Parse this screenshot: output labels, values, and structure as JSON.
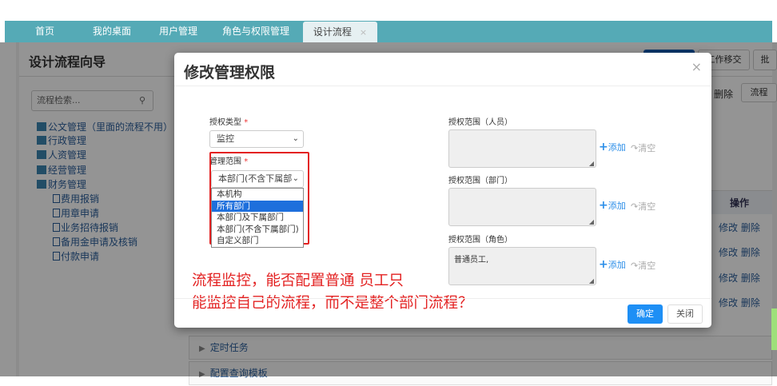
{
  "tabs": [
    {
      "label": "首页"
    },
    {
      "label": "我的桌面"
    },
    {
      "label": "用户管理"
    },
    {
      "label": "角色与权限管理"
    },
    {
      "label": "设计流程",
      "active": true,
      "close": "×"
    }
  ],
  "left": {
    "title": "设计流程向导",
    "search_placeholder": "流程检索...",
    "tree": [
      {
        "label": "公文管理（里面的流程不用）"
      },
      {
        "label": "行政管理"
      },
      {
        "label": "人资管理"
      },
      {
        "label": "经营管理"
      },
      {
        "label": "财务管理"
      }
    ],
    "sub": [
      {
        "label": "费用报销"
      },
      {
        "label": "用章申请"
      },
      {
        "label": "业务招待报销"
      },
      {
        "label": "备用金申请及核销"
      },
      {
        "label": "付款申请"
      }
    ]
  },
  "right": {
    "btn_transfer": "工作移交",
    "btn_batch": "批",
    "delete": "删除",
    "btn_flow": "流程",
    "col_action": "操作",
    "row_actions": [
      "修改 删除",
      "修改 删除",
      "修改 删除",
      "修改 删除"
    ],
    "accordions": [
      "定时任务",
      "配置查询模板"
    ]
  },
  "modal": {
    "title": "修改管理权限",
    "close": "×",
    "auth_type_label": "授权类型",
    "auth_type_value": "监控",
    "required": "*",
    "scope_label": "管理范围",
    "scope_value": "本部门(不含下属部",
    "scope_options": [
      "本机构",
      "所有部门",
      "本部门及下属部门",
      "本部门(不含下属部门)",
      "自定义部门"
    ],
    "scope_highlight": 1,
    "person_label": "授权范围（人员）",
    "dept_label": "授权范围（部门）",
    "role_label": "授权范围（角色）",
    "role_value": "普通员工,",
    "add": "添加",
    "clear": "清空",
    "ok": "确定",
    "cancel": "关闭"
  },
  "annotation": [
    "流程监控，能否配置普通 员工只",
    "能监控自己的流程，而不是整个部门流程？"
  ]
}
